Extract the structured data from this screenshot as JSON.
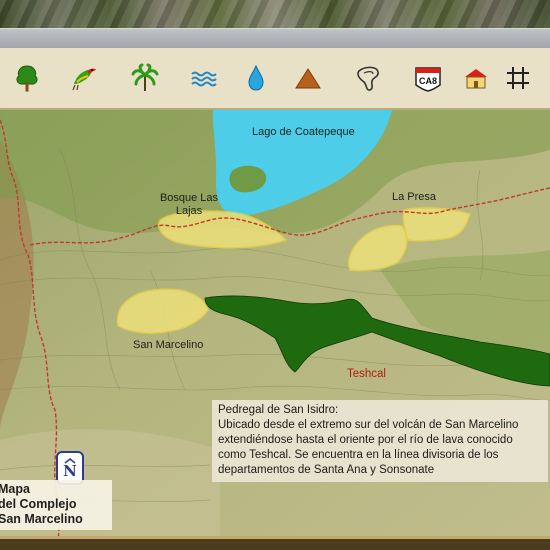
{
  "toolbar": {
    "icons": [
      {
        "name": "tree-icon"
      },
      {
        "name": "bird-icon"
      },
      {
        "name": "palm-icon"
      },
      {
        "name": "water-waves-icon"
      },
      {
        "name": "water-drop-icon"
      },
      {
        "name": "volcano-icon"
      },
      {
        "name": "lava-flow-icon"
      },
      {
        "name": "road-ca8-icon",
        "label": "CA8"
      },
      {
        "name": "house-icon"
      },
      {
        "name": "grid-icon"
      }
    ]
  },
  "map": {
    "labels": {
      "lago": "Lago de Coatepeque",
      "bosque": "Bosque Las Lajas",
      "la_presa": "La Presa",
      "san_marcelino": "San Marcelino",
      "teshcal": "Teshcal"
    },
    "colors": {
      "lake": "#4dcde8",
      "protected_area": "#f0e27a",
      "lava_flow": "#1f6a0e",
      "boundary_line": "#c2392c"
    }
  },
  "info": {
    "lines": [
      "Pedregal de San Isidro:",
      "Ubicado desde el extremo sur del volcán de San Marcelino",
      "extendiéndose hasta el oriente por el río de lava conocido",
      "como Teshcal. Se encuentra en la línea divisoria de los",
      "departamentos de Santa Ana y Sonsonate"
    ]
  },
  "north": {
    "letter": "N"
  },
  "title": {
    "lines": [
      "Mapa",
      "del Complejo",
      "San Marcelino"
    ]
  }
}
